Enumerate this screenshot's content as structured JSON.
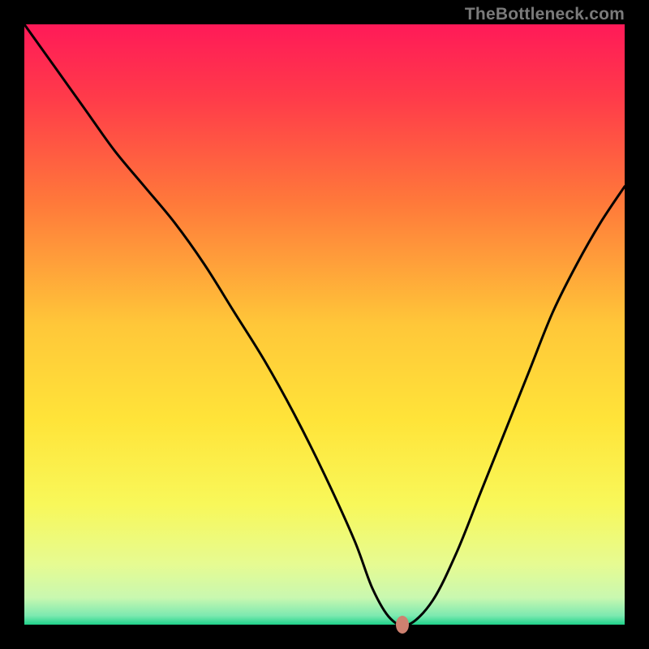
{
  "attribution": "TheBottleneck.com",
  "chart_data": {
    "type": "line",
    "title": "",
    "xlabel": "",
    "ylabel": "",
    "xlim": [
      0,
      100
    ],
    "ylim": [
      0,
      100
    ],
    "series": [
      {
        "name": "bottleneck-curve",
        "x": [
          0,
          5,
          10,
          15,
          20,
          25,
          30,
          35,
          40,
          45,
          50,
          55,
          58,
          61,
          64,
          68,
          72,
          76,
          80,
          84,
          88,
          92,
          96,
          100
        ],
        "values": [
          100,
          93,
          86,
          79,
          73,
          67,
          60,
          52,
          44,
          35,
          25,
          14,
          6,
          1,
          0,
          4,
          12,
          22,
          32,
          42,
          52,
          60,
          67,
          73
        ]
      }
    ],
    "optimal_point": {
      "x": 63,
      "y": 0
    },
    "background_gradient": {
      "stops": [
        {
          "pos": 0.0,
          "color": "#ff1a58"
        },
        {
          "pos": 0.12,
          "color": "#ff3a4a"
        },
        {
          "pos": 0.3,
          "color": "#ff7a3a"
        },
        {
          "pos": 0.5,
          "color": "#ffc739"
        },
        {
          "pos": 0.66,
          "color": "#ffe439"
        },
        {
          "pos": 0.8,
          "color": "#f8f85a"
        },
        {
          "pos": 0.9,
          "color": "#e6fb92"
        },
        {
          "pos": 0.955,
          "color": "#c9f8b0"
        },
        {
          "pos": 0.985,
          "color": "#7ce9b0"
        },
        {
          "pos": 1.0,
          "color": "#1fd28a"
        }
      ]
    }
  }
}
